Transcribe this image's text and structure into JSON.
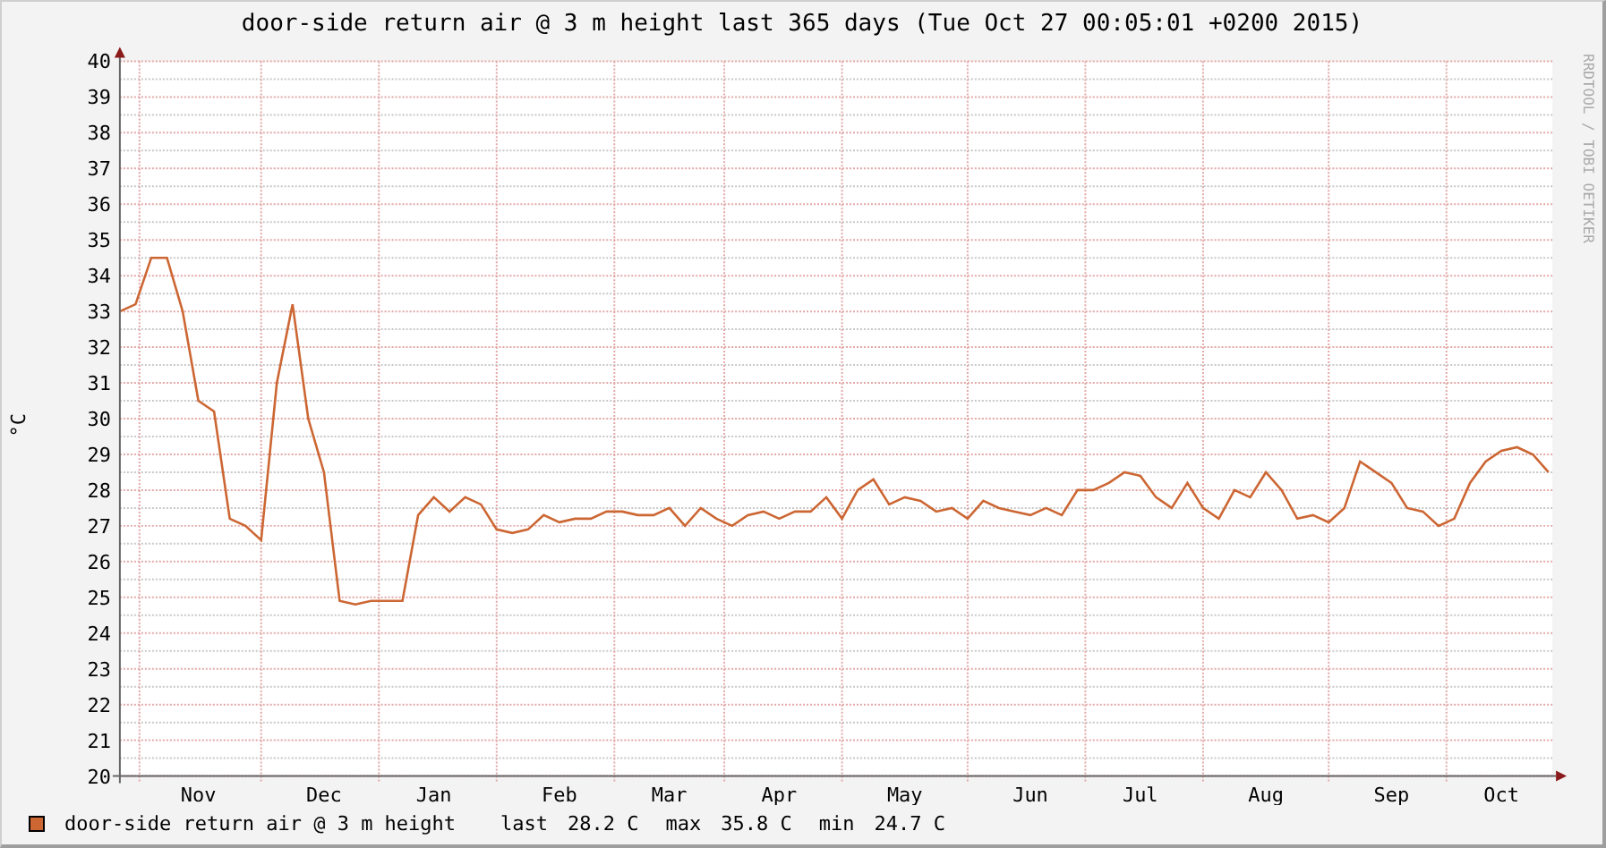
{
  "graph": {
    "credit": "RRDTOOL / TOBI OETIKER",
    "chart_data": {
      "type": "line",
      "grid": true,
      "title": "door-side return air @ 3 m height last 365 days (Tue Oct 27 00:05:01 +0200 2015)",
      "ylabel": "°C",
      "ylim": [
        20,
        40
      ],
      "yticks": [
        20,
        21,
        22,
        23,
        24,
        25,
        26,
        27,
        28,
        29,
        30,
        31,
        32,
        33,
        34,
        35,
        36,
        37,
        38,
        39,
        40
      ],
      "categories": [
        null,
        null,
        null,
        null,
        null,
        "Nov",
        null,
        null,
        null,
        null,
        null,
        null,
        null,
        "Dec",
        null,
        null,
        null,
        null,
        null,
        null,
        "Jan",
        null,
        null,
        null,
        null,
        null,
        null,
        null,
        "Feb",
        null,
        null,
        null,
        null,
        null,
        null,
        "Mar",
        null,
        null,
        null,
        null,
        null,
        null,
        "Apr",
        null,
        null,
        null,
        null,
        null,
        null,
        null,
        "May",
        null,
        null,
        null,
        null,
        null,
        null,
        null,
        "Jun",
        null,
        null,
        null,
        null,
        null,
        null,
        "Jul",
        null,
        null,
        null,
        null,
        null,
        null,
        null,
        "Aug",
        null,
        null,
        null,
        null,
        null,
        null,
        null,
        "Sep",
        null,
        null,
        null,
        null,
        null,
        null,
        "Oct",
        null,
        null,
        null
      ],
      "series": [
        {
          "color": "#cc6633",
          "values": [
            33.0,
            33.2,
            34.5,
            34.5,
            33.0,
            30.5,
            30.2,
            27.2,
            27.0,
            26.6,
            31.0,
            33.2,
            30.0,
            28.5,
            24.9,
            24.8,
            24.9,
            24.9,
            24.9,
            27.3,
            27.8,
            27.4,
            27.8,
            27.6,
            26.9,
            26.8,
            26.9,
            27.3,
            27.1,
            27.2,
            27.2,
            27.4,
            27.4,
            27.3,
            27.3,
            27.5,
            27.0,
            27.5,
            27.2,
            27.0,
            27.3,
            27.4,
            27.2,
            27.4,
            27.4,
            27.8,
            27.2,
            28.0,
            28.3,
            27.6,
            27.8,
            27.7,
            27.4,
            27.5,
            27.2,
            27.7,
            27.5,
            27.4,
            27.3,
            27.5,
            27.3,
            28.0,
            28.0,
            28.2,
            28.5,
            28.4,
            27.8,
            27.5,
            28.2,
            27.5,
            27.2,
            28.0,
            27.8,
            28.5,
            28.0,
            27.2,
            27.3,
            27.1,
            27.5,
            28.8,
            28.5,
            28.2,
            27.5,
            27.4,
            27.0,
            27.2,
            28.2,
            28.8,
            29.1,
            29.2,
            29.0,
            28.5
          ]
        }
      ]
    },
    "legend": {
      "label": "door-side return air @ 3 m height",
      "stats": [
        {
          "name": "last",
          "value": "28.2 C"
        },
        {
          "name": "max",
          "value": "35.8 C"
        },
        {
          "name": "min",
          "value": "24.7 C"
        }
      ]
    }
  }
}
